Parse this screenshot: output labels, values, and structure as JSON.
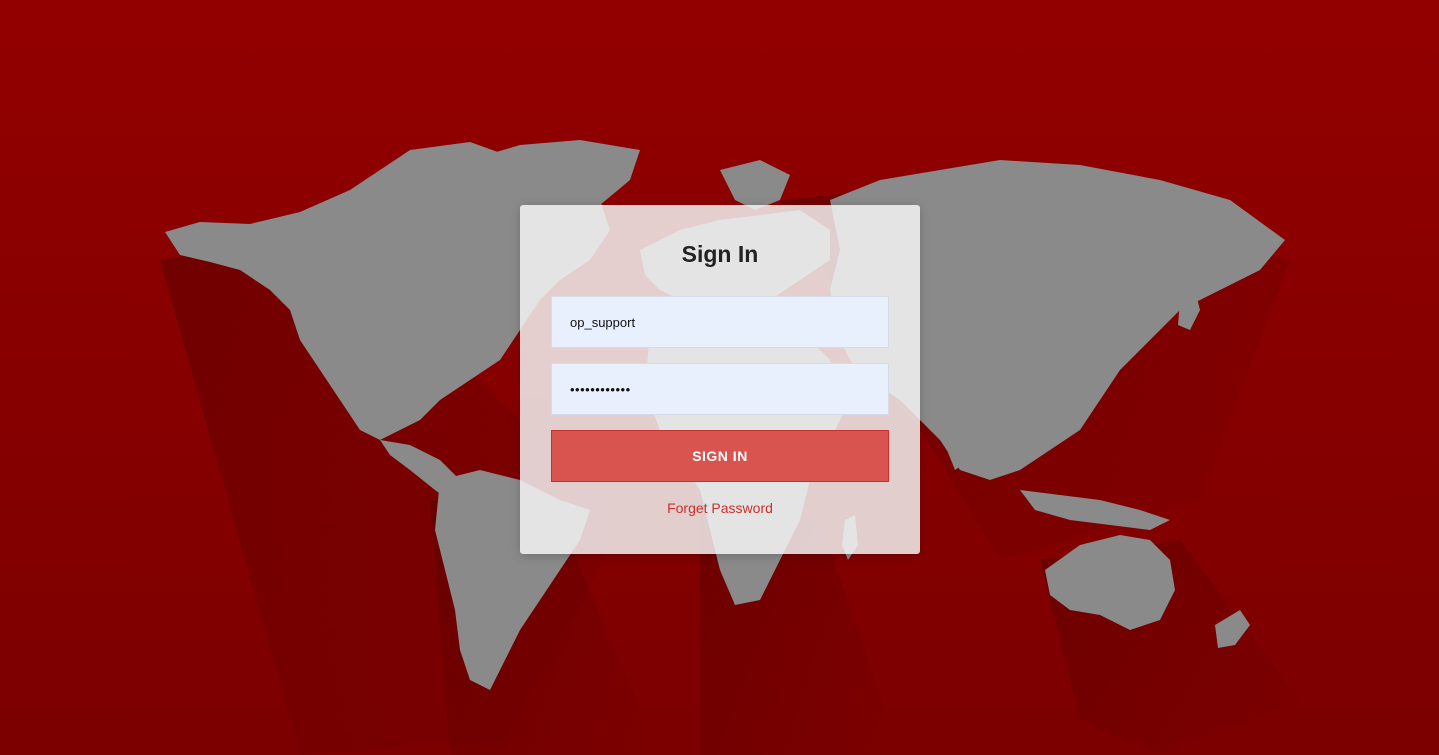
{
  "login": {
    "title": "Sign In",
    "username_value": "op_support",
    "password_value": "••••••••••••",
    "submit_label": "SIGN IN",
    "forgot_label": "Forget Password"
  },
  "colors": {
    "background": "#8c0000",
    "map": "#8a8a8a",
    "button": "#d9534f",
    "link": "#c9302c",
    "input_background": "#e8f0fe"
  }
}
